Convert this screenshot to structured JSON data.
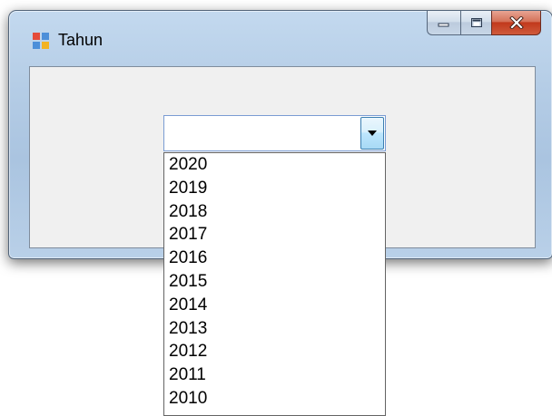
{
  "window": {
    "title": "Tahun",
    "icon": "form-icon",
    "caption_buttons": [
      "minimize-icon",
      "maximize-icon",
      "close-icon"
    ]
  },
  "combo": {
    "value": ""
  },
  "dropdown": {
    "options": [
      "2020",
      "2019",
      "2018",
      "2017",
      "2016",
      "2015",
      "2014",
      "2013",
      "2012",
      "2011",
      "2010"
    ]
  },
  "colors": {
    "client_background": "#f0f0f0",
    "close_button": "#c1391c",
    "combo_border": "#7a9cd3"
  }
}
